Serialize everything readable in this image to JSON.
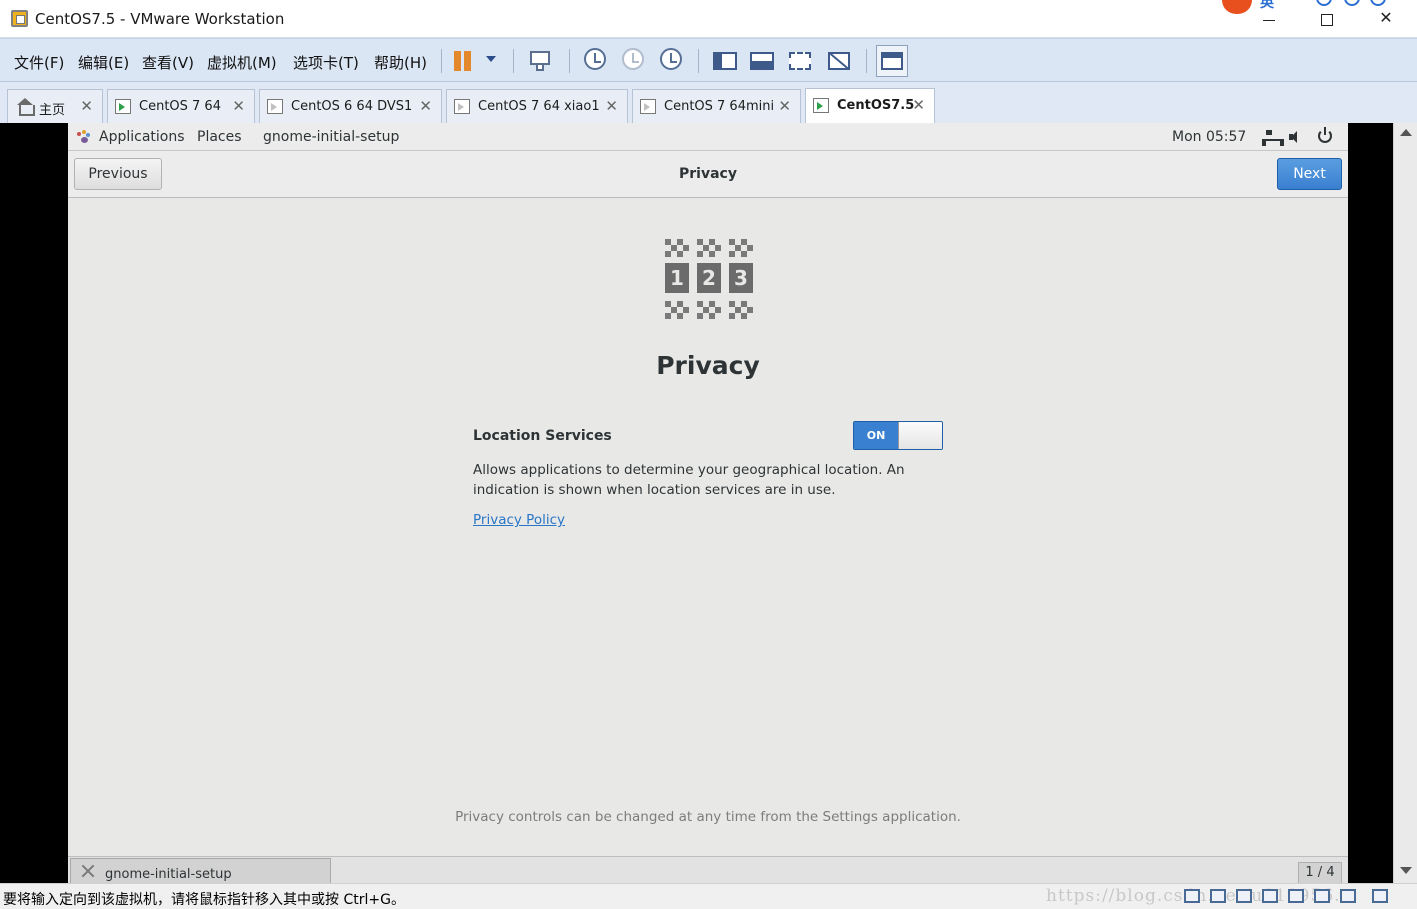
{
  "window": {
    "title": "CentOS7.5 - VMware Workstation",
    "tray_lang": "英"
  },
  "menu": [
    "文件(F)",
    "编辑(E)",
    "查看(V)",
    "虚拟机(M)",
    "选项卡(T)",
    "帮助(H)"
  ],
  "tabs": [
    {
      "label": "主页",
      "icon": "home-icon",
      "active": false
    },
    {
      "label": "CentOS 7 64",
      "icon": "vm-running-icon",
      "active": false
    },
    {
      "label": "CentOS 6 64 DVS1",
      "icon": "vm-off-icon",
      "active": false
    },
    {
      "label": "CentOS 7 64 xiao1",
      "icon": "vm-off-icon",
      "active": false
    },
    {
      "label": "CentOS 7 64mini",
      "icon": "vm-off-icon",
      "active": false
    },
    {
      "label": "CentOS7.5",
      "icon": "vm-running-icon",
      "active": true
    }
  ],
  "gnome_top": {
    "applications": "Applications",
    "places": "Places",
    "app_name": "gnome-initial-setup",
    "clock": "Mon 05:57"
  },
  "header": {
    "previous": "Previous",
    "title": "Privacy",
    "next": "Next"
  },
  "privacy": {
    "digits": [
      "1",
      "2",
      "3"
    ],
    "heading": "Privacy",
    "location_label": "Location Services",
    "location_toggle": "ON",
    "location_desc": "Allows applications to determine your geographical location. An indication is shown when location services are in use.",
    "policy_link": "Privacy Policy",
    "footnote": "Privacy controls can be changed at any time from the Settings application."
  },
  "gnome_bottom": {
    "task": "gnome-initial-setup",
    "workspace": "1 / 4"
  },
  "status": {
    "text": "要将输入定向到该虚拟机，请将鼠标指针移入其中或按 Ctrl+G。",
    "watermark": "https://blog.csdn.net/u010956..."
  },
  "colors": {
    "accent": "#3a80d0",
    "menubar": "#dbe6f4",
    "guest_bg": "#e8e8e7"
  }
}
